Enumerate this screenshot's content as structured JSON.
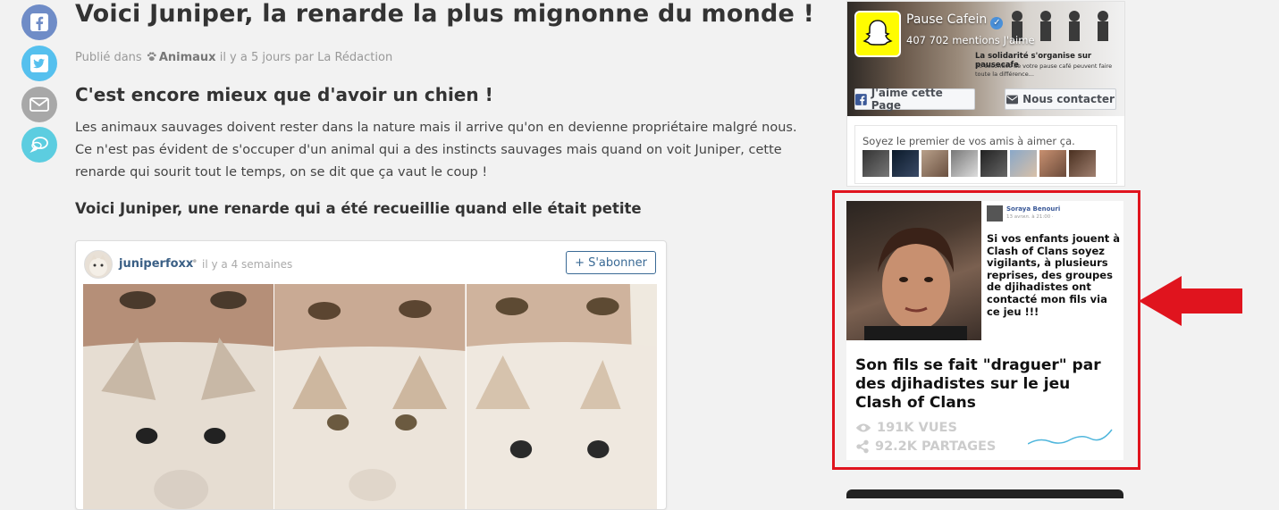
{
  "share": {
    "facebook": "facebook-icon",
    "twitter": "twitter-icon",
    "email": "mail-icon",
    "comment": "comment-icon"
  },
  "article": {
    "title": "Voici Juniper, la renarde la plus mignonne du monde !",
    "meta_prefix": "Publié dans",
    "category": "Animaux",
    "meta_suffix": "il y a 5 jours par La Rédaction",
    "subtitle": "C'est encore mieux que d'avoir un chien !",
    "paragraph": "Les animaux sauvages doivent rester dans la nature mais il arrive qu'on en devienne propriétaire malgré nous. Ce n'est pas évident de s'occuper d'un animal qui a des instincts sauvages mais quand on voit Juniper, cette renarde qui sourit tout le temps, on se dit que ça vaut le coup !",
    "section_heading": "Voici Juniper, une renarde qui a été recueillie quand elle était petite"
  },
  "instagram": {
    "username": "juniperfoxx",
    "dot": "•",
    "time": "il y a 4 semaines",
    "follow_label": "+ S'abonner"
  },
  "fb_widget": {
    "page_name": "Pause Cafein",
    "likes": "407 702 mentions J'aime",
    "slogan": "La solidarité s'organise sur pausecafe",
    "sub": "30 secondes de votre pause café peuvent faire toute la différence...",
    "like_label": "J'aime cette Page",
    "contact_label": "Nous contacter",
    "friends_text": "Soyez le premier de vos amis à aimer ça."
  },
  "promo": {
    "post_author": "Soraya Benouri",
    "post_meta": "13 avrил. à 21:00 ·",
    "post_text": "Si vos enfants jouent à Clash of Clans soyez vigilants, à plusieurs reprises, des groupes de djihadistes ont contacté mon fils via ce jeu !!!",
    "headline": "Son fils se fait \"draguer\" par des djihadistes sur le jeu Clash of Clans",
    "views": "191K VUES",
    "shares": "92.2K PARTAGES"
  },
  "colors": {
    "highlight_box": "#e0141e",
    "fb_blue": "#3b5998",
    "link": "#3a5f85"
  }
}
